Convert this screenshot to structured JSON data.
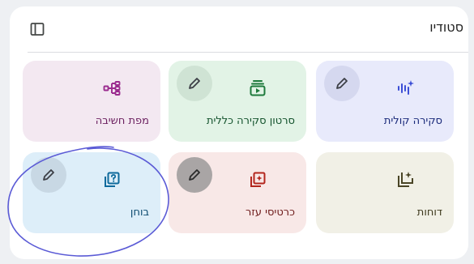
{
  "studio": {
    "title": "סטודיו",
    "icons": {
      "collapse": "side-panel-icon",
      "edit": "pencil-icon"
    },
    "cards": [
      {
        "id": "audio-overview",
        "label": "סקירה קולית",
        "icon": "audio-waveform-sparkle-icon",
        "color": "#3c4fd6"
      },
      {
        "id": "video-overview",
        "label": "סרטון סקירה כללית",
        "icon": "video-stack-icon",
        "color": "#1e7a3c"
      },
      {
        "id": "mind-map",
        "label": "מפת חשיבה",
        "icon": "mind-map-icon",
        "color": "#9b2c8f"
      },
      {
        "id": "reports",
        "label": "דוחות",
        "icon": "report-sparkle-icon",
        "color": "#4a4526"
      },
      {
        "id": "flashcards",
        "label": "כרטיסי עזר",
        "icon": "flashcards-icon",
        "color": "#b3261e"
      },
      {
        "id": "quiz",
        "label": "בוחן",
        "icon": "quiz-icon",
        "color": "#0e6a9c"
      }
    ]
  }
}
